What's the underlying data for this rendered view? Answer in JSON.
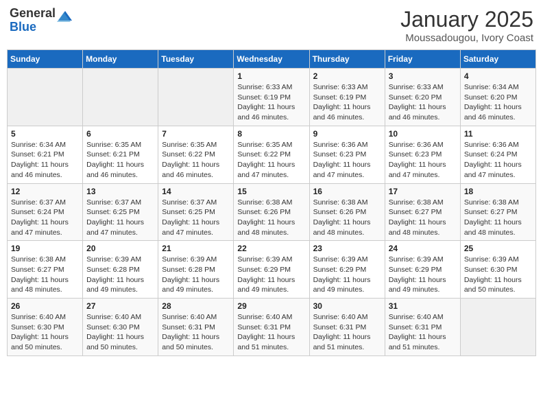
{
  "header": {
    "logo_general": "General",
    "logo_blue": "Blue",
    "month_title": "January 2025",
    "location": "Moussadougou, Ivory Coast"
  },
  "weekdays": [
    "Sunday",
    "Monday",
    "Tuesday",
    "Wednesday",
    "Thursday",
    "Friday",
    "Saturday"
  ],
  "weeks": [
    [
      {
        "day": "",
        "info": ""
      },
      {
        "day": "",
        "info": ""
      },
      {
        "day": "",
        "info": ""
      },
      {
        "day": "1",
        "info": "Sunrise: 6:33 AM\nSunset: 6:19 PM\nDaylight: 11 hours and 46 minutes."
      },
      {
        "day": "2",
        "info": "Sunrise: 6:33 AM\nSunset: 6:19 PM\nDaylight: 11 hours and 46 minutes."
      },
      {
        "day": "3",
        "info": "Sunrise: 6:33 AM\nSunset: 6:20 PM\nDaylight: 11 hours and 46 minutes."
      },
      {
        "day": "4",
        "info": "Sunrise: 6:34 AM\nSunset: 6:20 PM\nDaylight: 11 hours and 46 minutes."
      }
    ],
    [
      {
        "day": "5",
        "info": "Sunrise: 6:34 AM\nSunset: 6:21 PM\nDaylight: 11 hours and 46 minutes."
      },
      {
        "day": "6",
        "info": "Sunrise: 6:35 AM\nSunset: 6:21 PM\nDaylight: 11 hours and 46 minutes."
      },
      {
        "day": "7",
        "info": "Sunrise: 6:35 AM\nSunset: 6:22 PM\nDaylight: 11 hours and 46 minutes."
      },
      {
        "day": "8",
        "info": "Sunrise: 6:35 AM\nSunset: 6:22 PM\nDaylight: 11 hours and 47 minutes."
      },
      {
        "day": "9",
        "info": "Sunrise: 6:36 AM\nSunset: 6:23 PM\nDaylight: 11 hours and 47 minutes."
      },
      {
        "day": "10",
        "info": "Sunrise: 6:36 AM\nSunset: 6:23 PM\nDaylight: 11 hours and 47 minutes."
      },
      {
        "day": "11",
        "info": "Sunrise: 6:36 AM\nSunset: 6:24 PM\nDaylight: 11 hours and 47 minutes."
      }
    ],
    [
      {
        "day": "12",
        "info": "Sunrise: 6:37 AM\nSunset: 6:24 PM\nDaylight: 11 hours and 47 minutes."
      },
      {
        "day": "13",
        "info": "Sunrise: 6:37 AM\nSunset: 6:25 PM\nDaylight: 11 hours and 47 minutes."
      },
      {
        "day": "14",
        "info": "Sunrise: 6:37 AM\nSunset: 6:25 PM\nDaylight: 11 hours and 47 minutes."
      },
      {
        "day": "15",
        "info": "Sunrise: 6:38 AM\nSunset: 6:26 PM\nDaylight: 11 hours and 48 minutes."
      },
      {
        "day": "16",
        "info": "Sunrise: 6:38 AM\nSunset: 6:26 PM\nDaylight: 11 hours and 48 minutes."
      },
      {
        "day": "17",
        "info": "Sunrise: 6:38 AM\nSunset: 6:27 PM\nDaylight: 11 hours and 48 minutes."
      },
      {
        "day": "18",
        "info": "Sunrise: 6:38 AM\nSunset: 6:27 PM\nDaylight: 11 hours and 48 minutes."
      }
    ],
    [
      {
        "day": "19",
        "info": "Sunrise: 6:38 AM\nSunset: 6:27 PM\nDaylight: 11 hours and 48 minutes."
      },
      {
        "day": "20",
        "info": "Sunrise: 6:39 AM\nSunset: 6:28 PM\nDaylight: 11 hours and 49 minutes."
      },
      {
        "day": "21",
        "info": "Sunrise: 6:39 AM\nSunset: 6:28 PM\nDaylight: 11 hours and 49 minutes."
      },
      {
        "day": "22",
        "info": "Sunrise: 6:39 AM\nSunset: 6:29 PM\nDaylight: 11 hours and 49 minutes."
      },
      {
        "day": "23",
        "info": "Sunrise: 6:39 AM\nSunset: 6:29 PM\nDaylight: 11 hours and 49 minutes."
      },
      {
        "day": "24",
        "info": "Sunrise: 6:39 AM\nSunset: 6:29 PM\nDaylight: 11 hours and 49 minutes."
      },
      {
        "day": "25",
        "info": "Sunrise: 6:39 AM\nSunset: 6:30 PM\nDaylight: 11 hours and 50 minutes."
      }
    ],
    [
      {
        "day": "26",
        "info": "Sunrise: 6:40 AM\nSunset: 6:30 PM\nDaylight: 11 hours and 50 minutes."
      },
      {
        "day": "27",
        "info": "Sunrise: 6:40 AM\nSunset: 6:30 PM\nDaylight: 11 hours and 50 minutes."
      },
      {
        "day": "28",
        "info": "Sunrise: 6:40 AM\nSunset: 6:31 PM\nDaylight: 11 hours and 50 minutes."
      },
      {
        "day": "29",
        "info": "Sunrise: 6:40 AM\nSunset: 6:31 PM\nDaylight: 11 hours and 51 minutes."
      },
      {
        "day": "30",
        "info": "Sunrise: 6:40 AM\nSunset: 6:31 PM\nDaylight: 11 hours and 51 minutes."
      },
      {
        "day": "31",
        "info": "Sunrise: 6:40 AM\nSunset: 6:31 PM\nDaylight: 11 hours and 51 minutes."
      },
      {
        "day": "",
        "info": ""
      }
    ]
  ]
}
